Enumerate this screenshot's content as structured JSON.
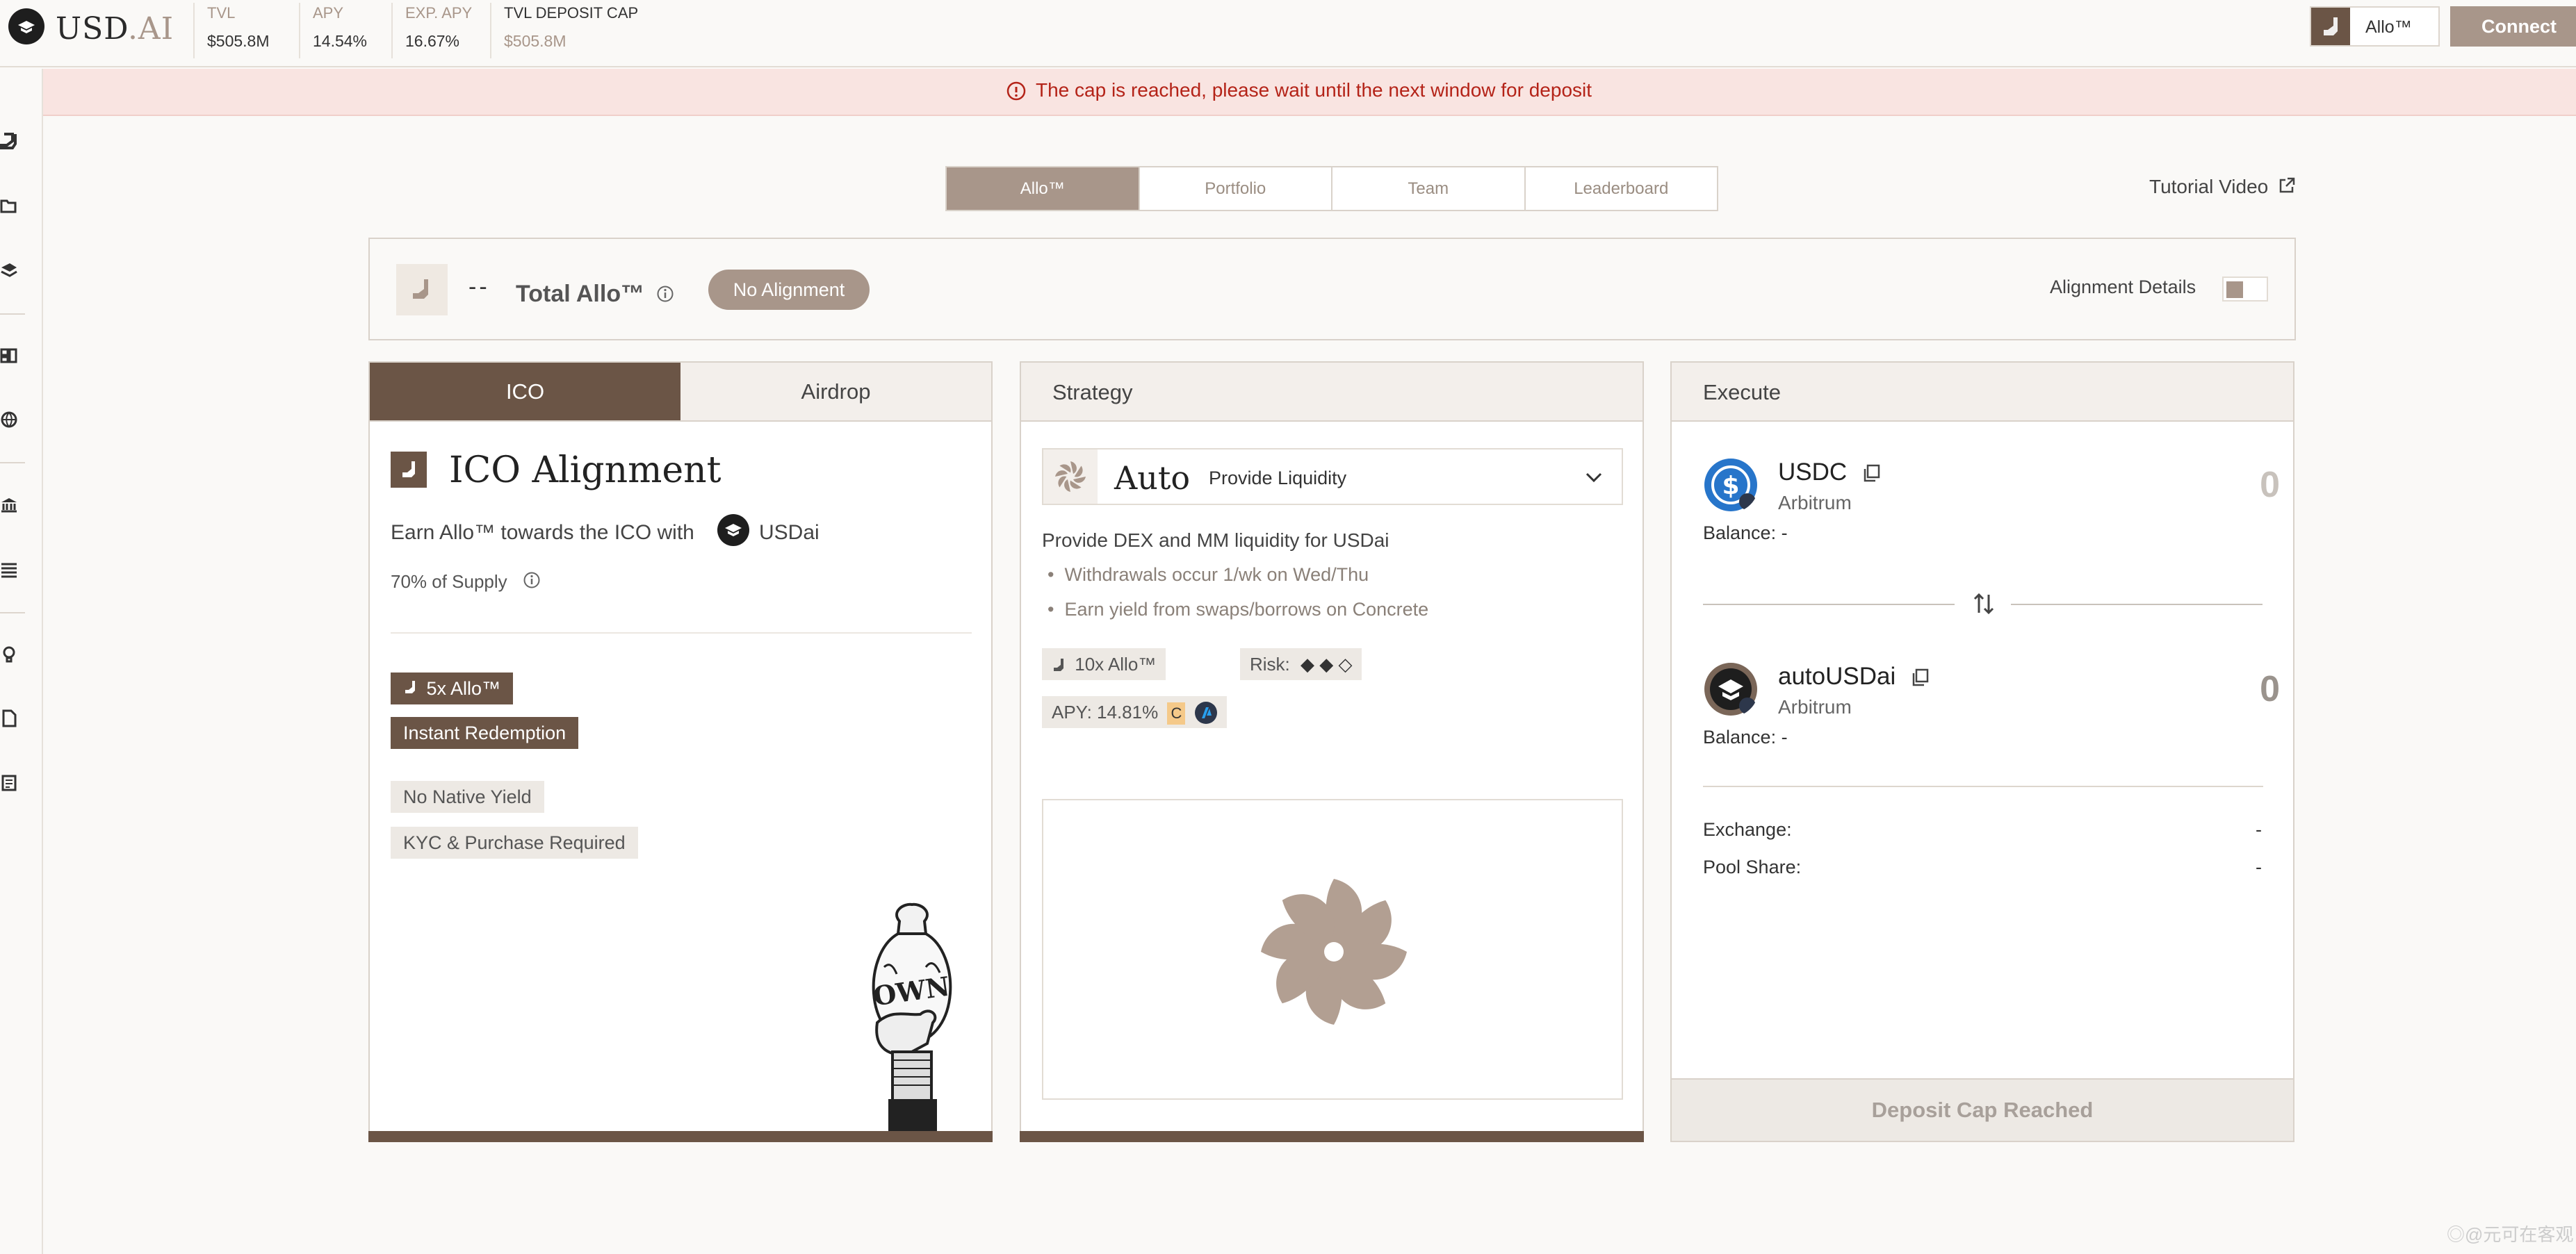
{
  "header": {
    "logo_main": "USD",
    "logo_accent": ".AI",
    "stats": [
      {
        "label": "TVL",
        "value": "$505.8M"
      },
      {
        "label": "APY",
        "value": "14.54%"
      },
      {
        "label": "EXP. APY",
        "value": "16.67%"
      },
      {
        "label": "TVL DEPOSIT CAP",
        "value": "$505.8M"
      }
    ],
    "allo_label": "Allo™",
    "connect_label": "Connect"
  },
  "banner": {
    "text": "The cap is reached, please wait until the next window for deposit"
  },
  "tabs": [
    {
      "label": "Allo™",
      "active": true
    },
    {
      "label": "Portfolio",
      "active": false
    },
    {
      "label": "Team",
      "active": false
    },
    {
      "label": "Leaderboard",
      "active": false
    }
  ],
  "tutorial_label": "Tutorial Video",
  "summary": {
    "value": "--",
    "title": "Total Allo™",
    "pill": "No Alignment",
    "details_label": "Alignment Details"
  },
  "ico_panel": {
    "tabs": [
      "ICO",
      "Airdrop"
    ],
    "heading": "ICO Alignment",
    "desc": "Earn Allo™ towards the ICO with",
    "desc_token": "USDai",
    "supply": "70% of Supply",
    "tags_dark": [
      "5x Allo™",
      "Instant Redemption"
    ],
    "tags_light": [
      "No Native Yield",
      "KYC & Purchase Required"
    ],
    "illustration_text": "OWN"
  },
  "strategy_panel": {
    "title": "Strategy",
    "select_main": "Auto",
    "select_sub": "Provide Liquidity",
    "desc": "Provide DEX and MM liquidity for USDai",
    "bullets": [
      "Withdrawals occur 1/wk on Wed/Thu",
      "Earn yield from swaps/borrows on Concrete"
    ],
    "chip_allo": "10x Allo™",
    "chip_risk": "Risk:",
    "chip_risk_level": "◆ ◆ ◇",
    "chip_apy": "APY: 14.81%",
    "chip_apy_badge": "C"
  },
  "execute_panel": {
    "title": "Execute",
    "tokens": [
      {
        "name": "USDC",
        "network": "Arbitrum",
        "balance": "Balance: -",
        "amount": "0"
      },
      {
        "name": "autoUSDai",
        "network": "Arbitrum",
        "balance": "Balance: -",
        "amount": "0"
      }
    ],
    "exchange_label": "Exchange:",
    "exchange_value": "-",
    "pool_label": "Pool Share:",
    "pool_value": "-",
    "deposit_label": "Deposit Cap Reached"
  },
  "colors": {
    "brand_dark": "#6b5546",
    "brand_light": "#a8968a",
    "banner_bg": "#f9e4e1",
    "banner_text": "#b42318"
  },
  "watermark": "◎@元可在客观"
}
